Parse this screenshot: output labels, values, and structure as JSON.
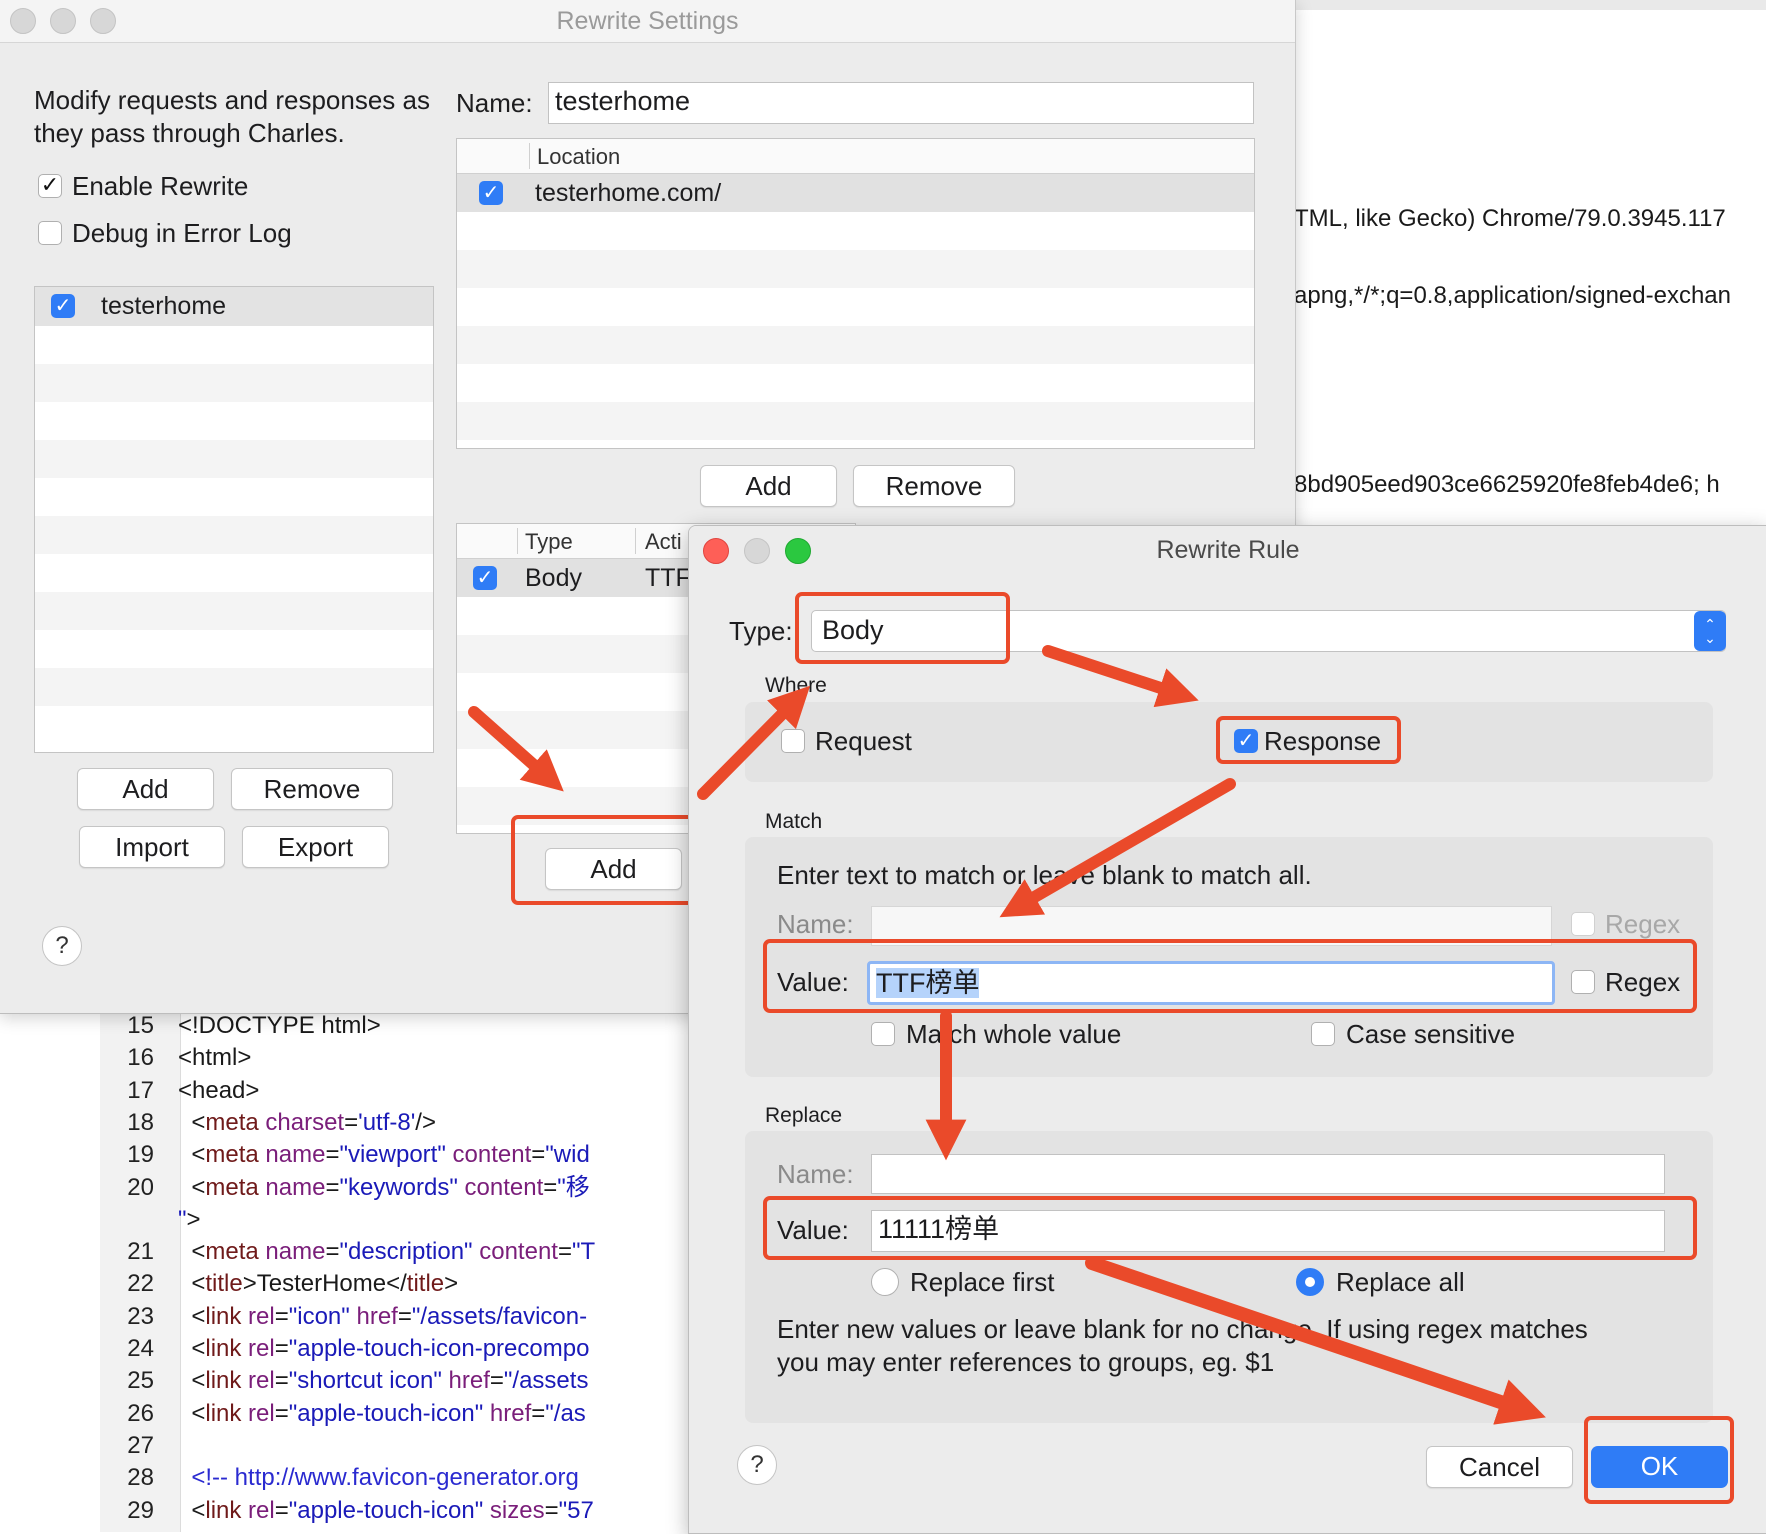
{
  "background": {
    "right_text": [
      "TML, like Gecko) Chrome/79.0.3945.117",
      "apng,*/*;q=0.8,application/signed-exchan",
      "8bd905eed903ce6625920fe8feb4de6; h"
    ],
    "code_lines": [
      {
        "num": "15",
        "parts": [
          {
            "c": "",
            "t": "<!DOCTYPE html>"
          }
        ]
      },
      {
        "num": "16",
        "parts": [
          {
            "c": "",
            "t": "<html>"
          }
        ]
      },
      {
        "num": "17",
        "parts": [
          {
            "c": "",
            "t": "<head>"
          }
        ]
      },
      {
        "num": "18",
        "parts": [
          {
            "c": "",
            "t": "  <"
          },
          {
            "c": "tag",
            "t": "meta "
          },
          {
            "c": "attr",
            "t": "charset"
          },
          {
            "c": "",
            "t": "="
          },
          {
            "c": "val",
            "t": "'utf-8'"
          },
          {
            "c": "",
            "t": "/>"
          }
        ]
      },
      {
        "num": "19",
        "parts": [
          {
            "c": "",
            "t": "  <"
          },
          {
            "c": "tag",
            "t": "meta "
          },
          {
            "c": "attr",
            "t": "name"
          },
          {
            "c": "",
            "t": "="
          },
          {
            "c": "val",
            "t": "\"viewport\""
          },
          {
            "c": "attr",
            "t": " content"
          },
          {
            "c": "",
            "t": "="
          },
          {
            "c": "val",
            "t": "\"wid"
          }
        ]
      },
      {
        "num": "20",
        "parts": [
          {
            "c": "",
            "t": "  <"
          },
          {
            "c": "tag",
            "t": "meta "
          },
          {
            "c": "attr",
            "t": "name"
          },
          {
            "c": "",
            "t": "="
          },
          {
            "c": "val",
            "t": "\"keywords\""
          },
          {
            "c": "attr",
            "t": " content"
          },
          {
            "c": "",
            "t": "="
          },
          {
            "c": "val",
            "t": "\"移"
          }
        ]
      },
      {
        "num": "",
        "parts": [
          {
            "c": "val",
            "t": "\""
          },
          {
            "c": "",
            "t": ">"
          }
        ]
      },
      {
        "num": "21",
        "parts": [
          {
            "c": "",
            "t": "  <"
          },
          {
            "c": "tag",
            "t": "meta "
          },
          {
            "c": "attr",
            "t": "name"
          },
          {
            "c": "",
            "t": "="
          },
          {
            "c": "val",
            "t": "\"description\""
          },
          {
            "c": "attr",
            "t": " content"
          },
          {
            "c": "",
            "t": "="
          },
          {
            "c": "val",
            "t": "\"T"
          }
        ]
      },
      {
        "num": "22",
        "parts": [
          {
            "c": "",
            "t": "  <"
          },
          {
            "c": "tag",
            "t": "title"
          },
          {
            "c": "",
            "t": ">TesterHome</"
          },
          {
            "c": "tag",
            "t": "title"
          },
          {
            "c": "",
            "t": ">"
          }
        ]
      },
      {
        "num": "23",
        "parts": [
          {
            "c": "",
            "t": "  <"
          },
          {
            "c": "tag",
            "t": "link "
          },
          {
            "c": "attr",
            "t": "rel"
          },
          {
            "c": "",
            "t": "="
          },
          {
            "c": "val",
            "t": "\"icon\""
          },
          {
            "c": "attr",
            "t": " href"
          },
          {
            "c": "",
            "t": "="
          },
          {
            "c": "val",
            "t": "\"/assets/favicon-"
          }
        ]
      },
      {
        "num": "24",
        "parts": [
          {
            "c": "",
            "t": "  <"
          },
          {
            "c": "tag",
            "t": "link "
          },
          {
            "c": "attr",
            "t": "rel"
          },
          {
            "c": "",
            "t": "="
          },
          {
            "c": "val",
            "t": "\"apple-touch-icon-precompo"
          }
        ]
      },
      {
        "num": "25",
        "parts": [
          {
            "c": "",
            "t": "  <"
          },
          {
            "c": "tag",
            "t": "link "
          },
          {
            "c": "attr",
            "t": "rel"
          },
          {
            "c": "",
            "t": "="
          },
          {
            "c": "val",
            "t": "\"shortcut icon\""
          },
          {
            "c": "attr",
            "t": " href"
          },
          {
            "c": "",
            "t": "="
          },
          {
            "c": "val",
            "t": "\"/assets"
          }
        ]
      },
      {
        "num": "26",
        "parts": [
          {
            "c": "",
            "t": "  <"
          },
          {
            "c": "tag",
            "t": "link "
          },
          {
            "c": "attr",
            "t": "rel"
          },
          {
            "c": "",
            "t": "="
          },
          {
            "c": "val",
            "t": "\"apple-touch-icon\""
          },
          {
            "c": "attr",
            "t": " href"
          },
          {
            "c": "",
            "t": "="
          },
          {
            "c": "val",
            "t": "\"/as"
          }
        ]
      },
      {
        "num": "27",
        "parts": [
          {
            "c": "",
            "t": ""
          }
        ]
      },
      {
        "num": "28",
        "parts": [
          {
            "c": "",
            "t": "  "
          },
          {
            "c": "com",
            "t": "<!-- http://www.favicon-generator.org"
          }
        ]
      },
      {
        "num": "29",
        "parts": [
          {
            "c": "",
            "t": "  <"
          },
          {
            "c": "tag",
            "t": "link "
          },
          {
            "c": "attr",
            "t": "rel"
          },
          {
            "c": "",
            "t": "="
          },
          {
            "c": "val",
            "t": "\"apple-touch-icon\""
          },
          {
            "c": "attr",
            "t": " sizes"
          },
          {
            "c": "",
            "t": "="
          },
          {
            "c": "val",
            "t": "\"57"
          }
        ]
      }
    ]
  },
  "settings": {
    "title": "Rewrite Settings",
    "description": "Modify requests and responses as they pass through Charles.",
    "enable_rewrite": {
      "label": "Enable Rewrite",
      "checked": true
    },
    "debug_log": {
      "label": "Debug in Error Log",
      "checked": false
    },
    "sets": [
      {
        "label": "testerhome",
        "checked": true
      }
    ],
    "set_buttons": {
      "add": "Add",
      "remove": "Remove",
      "import": "Import",
      "export": "Export"
    },
    "help": "?",
    "name_label": "Name:",
    "name_value": "testerhome",
    "locations": {
      "header": "Location",
      "rows": [
        {
          "label": "testerhome.com/",
          "checked": true
        }
      ]
    },
    "location_buttons": {
      "add": "Add",
      "remove": "Remove"
    },
    "rules": {
      "headers": [
        "Type",
        "Acti"
      ],
      "rows": [
        {
          "type": "Body",
          "action": "TTF",
          "checked": true
        }
      ]
    },
    "rule_buttons": {
      "add": "Add"
    }
  },
  "rule": {
    "title": "Rewrite Rule",
    "type_label": "Type:",
    "type_value": "Body",
    "where_label": "Where",
    "request": {
      "label": "Request",
      "checked": false
    },
    "response": {
      "label": "Response",
      "checked": true
    },
    "match_label": "Match",
    "match_hint": "Enter text to match or leave blank to match all.",
    "match_name_label": "Name:",
    "match_name_value": "",
    "match_name_regex": "Regex",
    "match_value_label": "Value:",
    "match_value_value": "TTF榜单",
    "match_value_regex": "Regex",
    "match_whole": "Match whole value",
    "case_sensitive": "Case sensitive",
    "replace_label": "Replace",
    "replace_name_label": "Name:",
    "replace_name_value": "",
    "replace_value_label": "Value:",
    "replace_value_value": "11111榜单",
    "replace_first": "Replace first",
    "replace_all": "Replace all",
    "replace_mode": "all",
    "replace_hint_1": "Enter new values or leave blank for no change. If using regex matches",
    "replace_hint_2": "you may enter references to groups, eg. $1",
    "help": "?",
    "cancel": "Cancel",
    "ok": "OK"
  },
  "colors": {
    "accent": "#2f7cf6",
    "annotation": "#ea4a2a"
  }
}
